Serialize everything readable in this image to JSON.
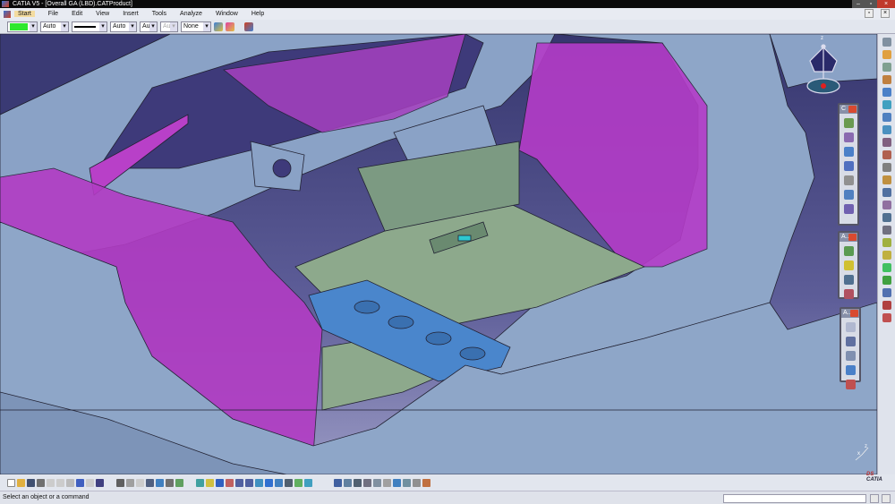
{
  "window": {
    "title": "CATIA V5 - [Overall GA (LBD).CATProduct]"
  },
  "menu": [
    "Start",
    "File",
    "Edit",
    "View",
    "Insert",
    "Tools",
    "Analyze",
    "Window",
    "Help"
  ],
  "graphic_properties": {
    "fill_color": "#2ee82e",
    "transparency": "Auto",
    "line_type": "Auto",
    "thickness": "Aut",
    "linetype2": "Aut",
    "layer": "None"
  },
  "floating_toolbars": [
    {
      "title": "C"
    },
    {
      "title": "A..."
    },
    {
      "title": "A..."
    }
  ],
  "compass": {
    "axis_label": "z"
  },
  "axis": {
    "x": "x",
    "z": "z"
  },
  "status": {
    "message": "Select an object or a command"
  },
  "brand": {
    "logo": "CATIA"
  },
  "colors": {
    "frame": "#8ea6c8",
    "panel": "#b23cc4",
    "floor": "#8ba88a",
    "channel": "#4a86cc"
  }
}
